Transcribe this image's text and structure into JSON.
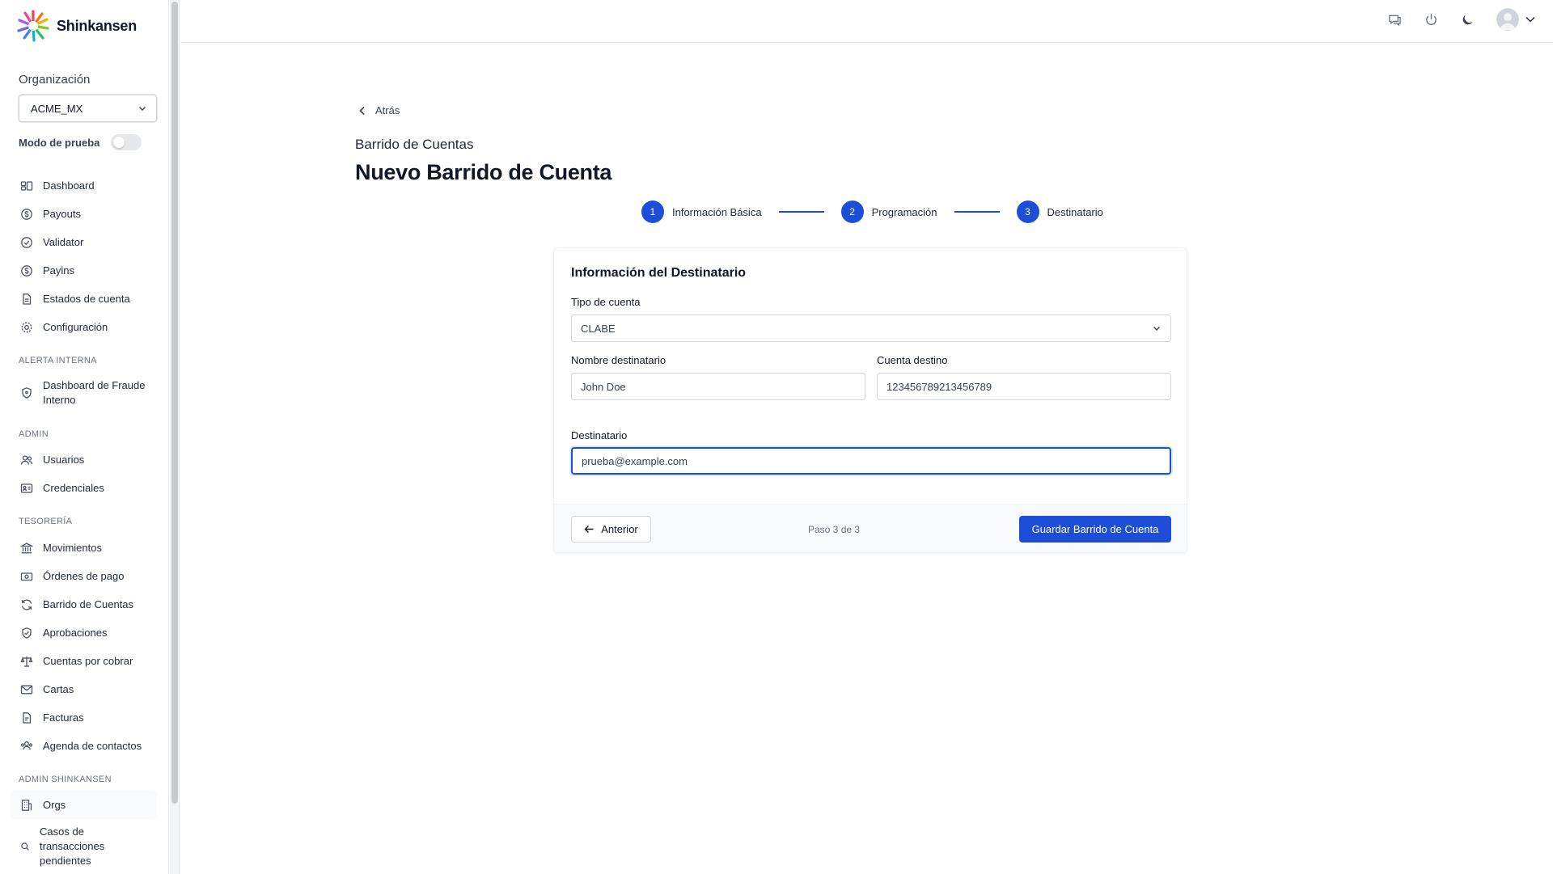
{
  "app": {
    "name": "Shinkansen"
  },
  "sidebar": {
    "org_label": "Organización",
    "org_value": "ACME_MX",
    "test_mode_label": "Modo de prueba",
    "test_mode_on": false,
    "main_items": [
      {
        "label": "Dashboard",
        "icon": "dashboard-icon"
      },
      {
        "label": "Payouts",
        "icon": "payouts-icon"
      },
      {
        "label": "Validator",
        "icon": "check-circle-icon"
      },
      {
        "label": "Payins",
        "icon": "payins-icon"
      },
      {
        "label": "Estados de cuenta",
        "icon": "document-icon"
      },
      {
        "label": "Configuración",
        "icon": "gear-icon"
      }
    ],
    "section_alerta": "ALERTA INTERNA",
    "alerta_items": [
      {
        "label": "Dashboard de Fraude Interno",
        "icon": "shield-icon"
      }
    ],
    "section_admin": "ADMIN",
    "admin_items": [
      {
        "label": "Usuarios",
        "icon": "users-icon"
      },
      {
        "label": "Credenciales",
        "icon": "id-card-icon"
      }
    ],
    "section_tesoreria": "TESORERÍA",
    "tesoreria_items": [
      {
        "label": "Movimientos",
        "icon": "bank-icon"
      },
      {
        "label": "Órdenes de pago",
        "icon": "cash-icon"
      },
      {
        "label": "Barrido de Cuentas",
        "icon": "refresh-icon"
      },
      {
        "label": "Aprobaciones",
        "icon": "shield-check-icon"
      },
      {
        "label": "Cuentas por cobrar",
        "icon": "scale-icon"
      },
      {
        "label": "Cartas",
        "icon": "envelope-icon"
      },
      {
        "label": "Facturas",
        "icon": "invoice-icon"
      },
      {
        "label": "Agenda de contactos",
        "icon": "contacts-icon"
      }
    ],
    "section_shinkansen": "ADMIN SHINKANSEN",
    "shinkansen_items": [
      {
        "label": "Orgs",
        "icon": "building-icon"
      },
      {
        "label": "Casos de transacciones pendientes",
        "icon": "search-icon"
      }
    ]
  },
  "page": {
    "back_label": "Atrás",
    "subtitle": "Barrido de Cuentas",
    "title": "Nuevo Barrido de Cuenta",
    "steps": [
      {
        "num": "1",
        "label": "Información Básica"
      },
      {
        "num": "2",
        "label": "Programación"
      },
      {
        "num": "3",
        "label": "Destinatario"
      }
    ]
  },
  "form": {
    "section_title": "Información del Destinatario",
    "tipo_label": "Tipo de cuenta",
    "tipo_value": "CLABE",
    "nombre_label": "Nombre destinatario",
    "nombre_value": "John Doe",
    "cuenta_label": "Cuenta destino",
    "cuenta_value": "123456789213456789",
    "destinatario_label": "Destinatario",
    "destinatario_value": "prueba@example.com",
    "prev_label": "Anterior",
    "step_count": "Paso 3 de 3",
    "save_label": "Guardar Barrido de Cuenta"
  },
  "colors": {
    "accent": "#1d4ed8"
  }
}
